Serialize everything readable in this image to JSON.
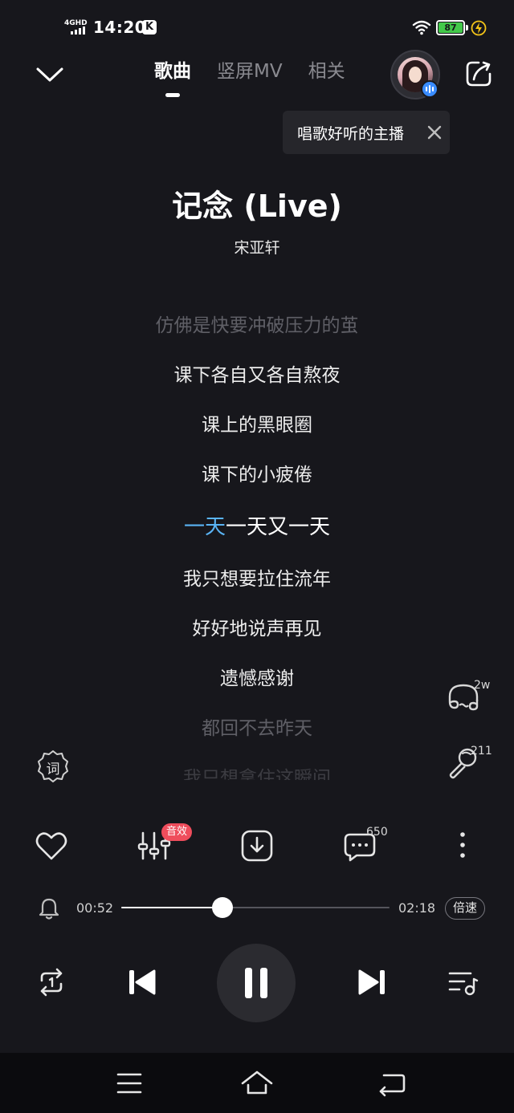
{
  "status_bar": {
    "network": "4GHD",
    "time": "14:20",
    "app_badge": "K",
    "battery": "87"
  },
  "header": {
    "tabs": [
      {
        "label": "歌曲",
        "active": true
      },
      {
        "label": "竖屏MV",
        "active": false
      },
      {
        "label": "相关",
        "active": false
      }
    ],
    "tooltip": "唱歌好听的主播"
  },
  "song": {
    "title": "记念 (Live)",
    "artist": "宋亚轩"
  },
  "lyrics": {
    "before": [
      "仿佛是快要冲破压力的茧",
      "课下各自又各自熬夜",
      "课上的黑眼圈",
      "课下的小疲倦"
    ],
    "current_sung": "一天",
    "current_rest": "一天又一天",
    "after": [
      "我只想要拉住流年",
      "好好地说声再见",
      "遗憾感谢",
      "都回不去昨天",
      "我只想拿住这瞬间"
    ]
  },
  "side": {
    "lyrics_label": "词",
    "listen_count": "2w",
    "sing_count": "211"
  },
  "actions": {
    "sfx_badge": "音效",
    "comment_count": "650"
  },
  "progress": {
    "current": "00:52",
    "total": "02:18",
    "fraction": 0.377,
    "speed_label": "倍速"
  },
  "colors": {
    "background": "#17171c",
    "accent_lyric": "#5ab4f5",
    "badge_red": "#ef4d5c",
    "battery_green": "#43c94a"
  }
}
